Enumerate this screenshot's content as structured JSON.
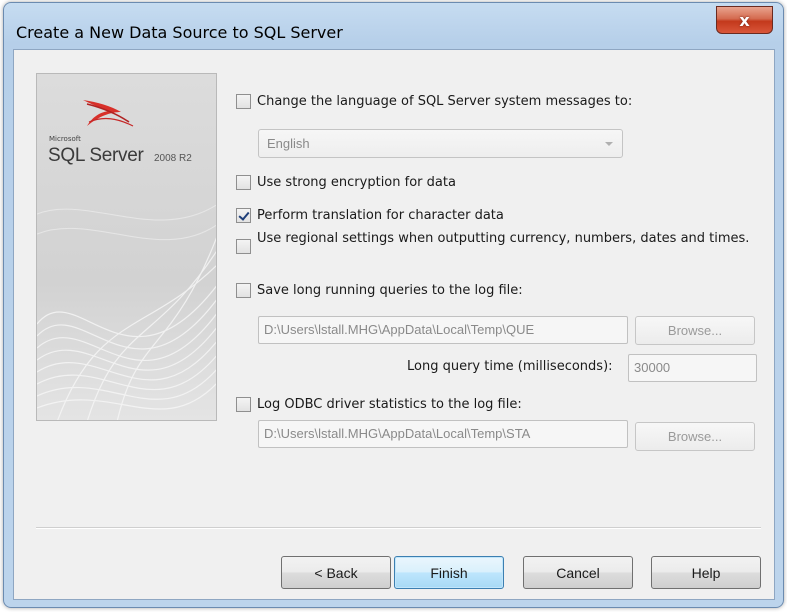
{
  "window": {
    "title": "Create a New Data Source to SQL Server",
    "close_glyph": "x"
  },
  "banner": {
    "brand_small": "Microsoft",
    "product": "SQL Server",
    "version": "2008 R2",
    "logo_icon": "sql-server-logo-icon"
  },
  "options": {
    "change_language": {
      "label": "Change the language of SQL Server system messages to:",
      "checked": false
    },
    "language_select": {
      "value": "English"
    },
    "strong_encryption": {
      "label": "Use strong encryption for data",
      "checked": false
    },
    "translation": {
      "label": "Perform translation for character data",
      "checked": true
    },
    "regional_settings": {
      "label": "Use regional settings when outputting currency, numbers, dates and times.",
      "checked": false
    },
    "long_queries": {
      "label": "Save long running queries to the log file:",
      "checked": false
    },
    "long_queries_path": {
      "value": "D:\\Users\\lstall.MHG\\AppData\\Local\\Temp\\QUE"
    },
    "long_queries_browse": "Browse...",
    "long_query_time_label": "Long query time (milliseconds):",
    "long_query_time_value": "30000",
    "odbc_stats": {
      "label": "Log ODBC driver statistics to the log file:",
      "checked": false
    },
    "odbc_stats_path": {
      "value": "D:\\Users\\lstall.MHG\\AppData\\Local\\Temp\\STA"
    },
    "odbc_stats_browse": "Browse..."
  },
  "buttons": {
    "back": "< Back",
    "finish": "Finish",
    "cancel": "Cancel",
    "help": "Help"
  },
  "colors": {
    "title_bar": "#bcd4ec",
    "close_button": "#c3391c",
    "default_button": "#bee6fd",
    "checkmark": "#1f3f7a"
  }
}
